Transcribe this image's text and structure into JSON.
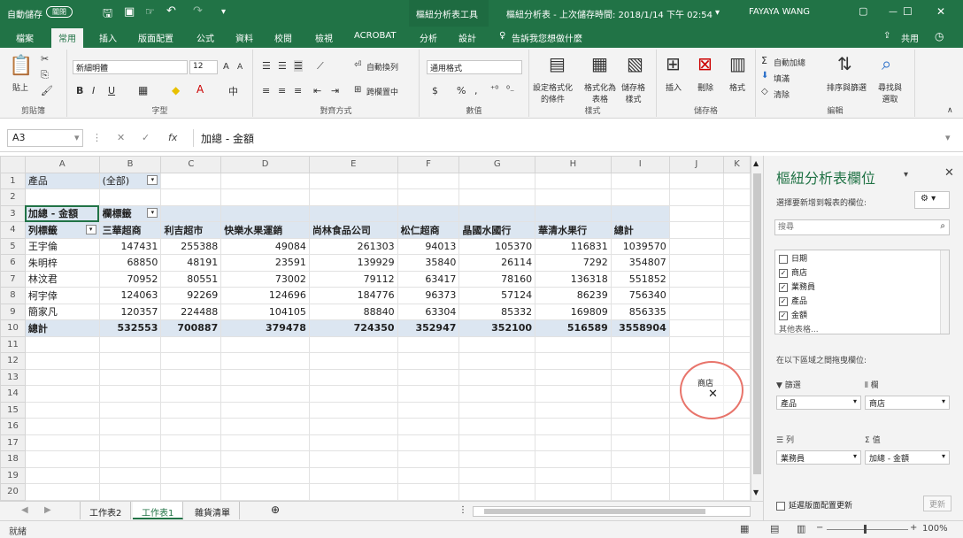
{
  "title": {
    "autosave_label": "自動儲存",
    "autosave_state": "關閉",
    "context_tab": "樞紐分析表工具",
    "doc": "樞紐分析表 - 上次儲存時間: 2018/1/14 下午 02:54",
    "user": "FAYAYA WANG",
    "ribbon_display": "▢",
    "minimize": "—",
    "maximize": "☐",
    "close": "✕"
  },
  "ribbon_tabs": [
    "檔案",
    "常用",
    "插入",
    "版面配置",
    "公式",
    "資料",
    "校閱",
    "檢視",
    "ACROBAT",
    "分析",
    "設計"
  ],
  "ribbon_search": "告訴我您想做什麼",
  "share": "共用",
  "ribbon": {
    "clipboard": {
      "label": "剪貼簿",
      "paste": "貼上"
    },
    "font": {
      "label": "字型",
      "name": "新細明體",
      "size": "12",
      "bold": "B",
      "italic": "I",
      "underline": "U",
      "grow": "A",
      "shrink": "A"
    },
    "alignment": {
      "label": "對齊方式",
      "wrap": "自動換列",
      "merge": "跨欄置中"
    },
    "number": {
      "label": "數值",
      "format": "通用格式",
      "currency": "$",
      "percent": "%",
      "comma": ","
    },
    "styles": {
      "label": "樣式",
      "cond": "設定格式化\n的條件",
      "table": "格式化為\n表格",
      "cell": "儲存格\n樣式"
    },
    "cells": {
      "label": "儲存格",
      "insert": "插入",
      "delete": "刪除",
      "format": "格式"
    },
    "editing": {
      "label": "編輯",
      "autosum": "自動加總",
      "fill": "填滿",
      "clear": "清除",
      "sort": "排序與篩選",
      "find": "尋找與\n選取"
    }
  },
  "formula": {
    "namebox": "A3",
    "content": "加總 - 金額",
    "fx": "fx",
    "cancel": "✕",
    "enter": "✓"
  },
  "grid": {
    "columns": [
      "A",
      "B",
      "C",
      "D",
      "E",
      "F",
      "G",
      "H",
      "I",
      "J",
      "K"
    ],
    "filter_label": "產品",
    "filter_value": "(全部)",
    "sum_label": "加總 - 金額",
    "col_label": "欄標籤",
    "row_label": "列標籤",
    "stores": [
      "三華超商",
      "利吉超市",
      "快樂水果運銷",
      "尚林食品公司",
      "松仁超商",
      "晶國水國行",
      "華清水果行",
      "總計"
    ],
    "rows": [
      {
        "name": "王宇倫",
        "v": [
          "147431",
          "255388",
          "49084",
          "261303",
          "94013",
          "105370",
          "116831",
          "1039570"
        ]
      },
      {
        "name": "朱明梓",
        "v": [
          "68850",
          "48191",
          "23591",
          "139929",
          "35840",
          "26114",
          "7292",
          "354807"
        ]
      },
      {
        "name": "林汶君",
        "v": [
          "70952",
          "80551",
          "73002",
          "79112",
          "63417",
          "78160",
          "136318",
          "551852"
        ]
      },
      {
        "name": "柯宇倖",
        "v": [
          "124063",
          "92269",
          "124696",
          "184776",
          "96373",
          "57124",
          "86239",
          "756340"
        ]
      },
      {
        "name": "簡家凡",
        "v": [
          "120357",
          "224488",
          "104105",
          "88840",
          "63304",
          "85332",
          "169809",
          "856335"
        ]
      }
    ],
    "total": {
      "name": "總計",
      "v": [
        "532553",
        "700887",
        "379478",
        "724350",
        "352947",
        "352100",
        "516589",
        "3558904"
      ]
    },
    "row_numbers": [
      "1",
      "2",
      "3",
      "4",
      "5",
      "6",
      "7",
      "8",
      "9",
      "10",
      "11",
      "12",
      "13",
      "14",
      "15",
      "16",
      "17",
      "18",
      "19",
      "20"
    ]
  },
  "sheets": [
    "工作表2",
    "工作表1",
    "雜貨清單"
  ],
  "active_sheet": "工作表1",
  "status": {
    "ready": "就緒",
    "zoom": "100%"
  },
  "pane": {
    "title": "樞紐分析表欄位",
    "choose": "選擇要新增到報表的欄位:",
    "search_placeholder": "搜尋",
    "fields": [
      {
        "name": "日期",
        "checked": false
      },
      {
        "name": "商店",
        "checked": true
      },
      {
        "name": "業務員",
        "checked": true
      },
      {
        "name": "產品",
        "checked": true
      },
      {
        "name": "金額",
        "checked": true
      }
    ],
    "more": "其他表格...",
    "drag": "在以下區域之間拖曳欄位:",
    "filters_title": "篩選",
    "filters_item": "產品",
    "columns_title": "欄",
    "columns_item": "商店",
    "rows_title": "列",
    "rows_item": "業務員",
    "values_title": "值",
    "values_item": "加總 - 金額",
    "defer": "延遲版面配置更新",
    "update": "更新"
  },
  "drag_label": "商店"
}
